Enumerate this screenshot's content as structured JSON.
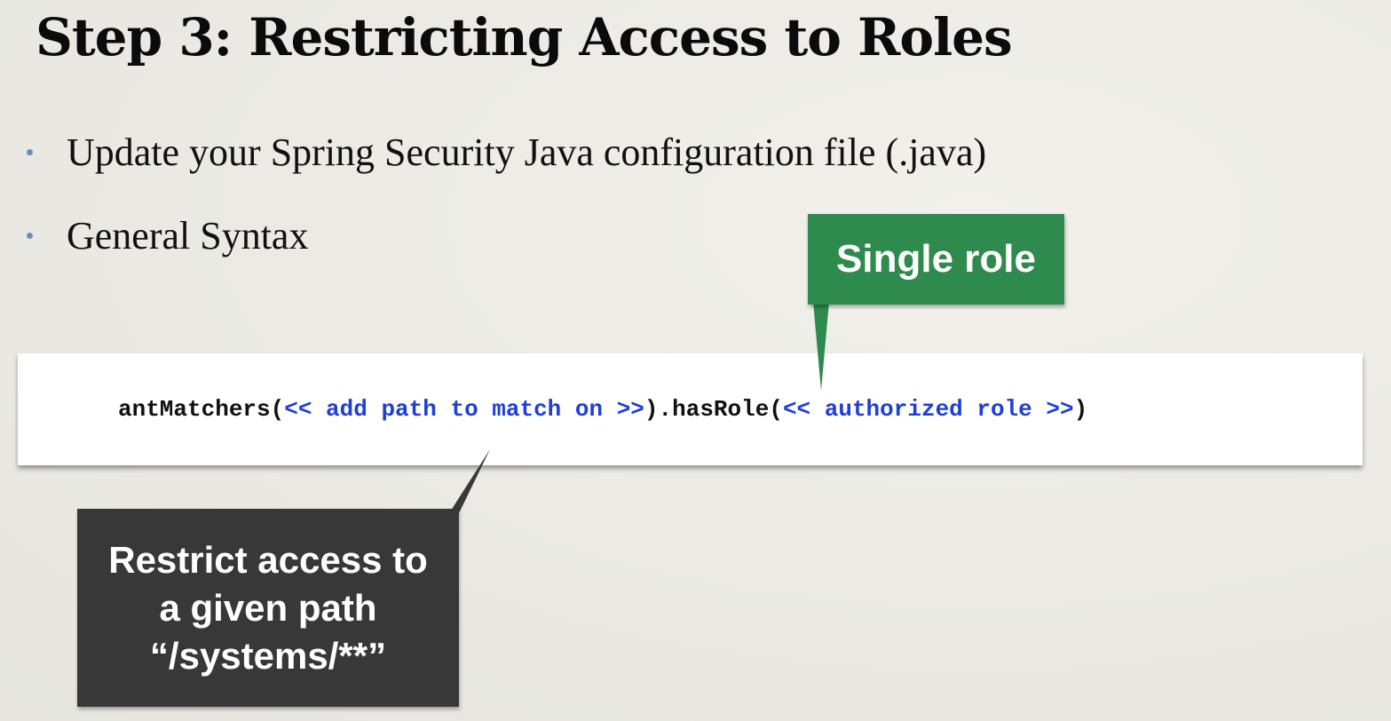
{
  "slide": {
    "title": "Step 3: Restricting Access to Roles",
    "bullets": [
      "Update your Spring Security Java configuration file (.java)",
      "General Syntax"
    ]
  },
  "code": {
    "method1": "antMatchers(",
    "placeholder1": "<< add path to match on >>",
    "method2": ").hasRole(",
    "placeholder2": "<< authorized role >>",
    "close": ")"
  },
  "callouts": {
    "role": {
      "label": "Single role",
      "color": "#2f8a4e"
    },
    "path": {
      "lines": [
        "Restrict access to",
        "a given path",
        "“/systems/**”"
      ],
      "color": "#383838"
    }
  },
  "colors": {
    "placeholder": "#1f3fd6",
    "bullet": "#6b8fb3",
    "background": "#ecebe6"
  }
}
